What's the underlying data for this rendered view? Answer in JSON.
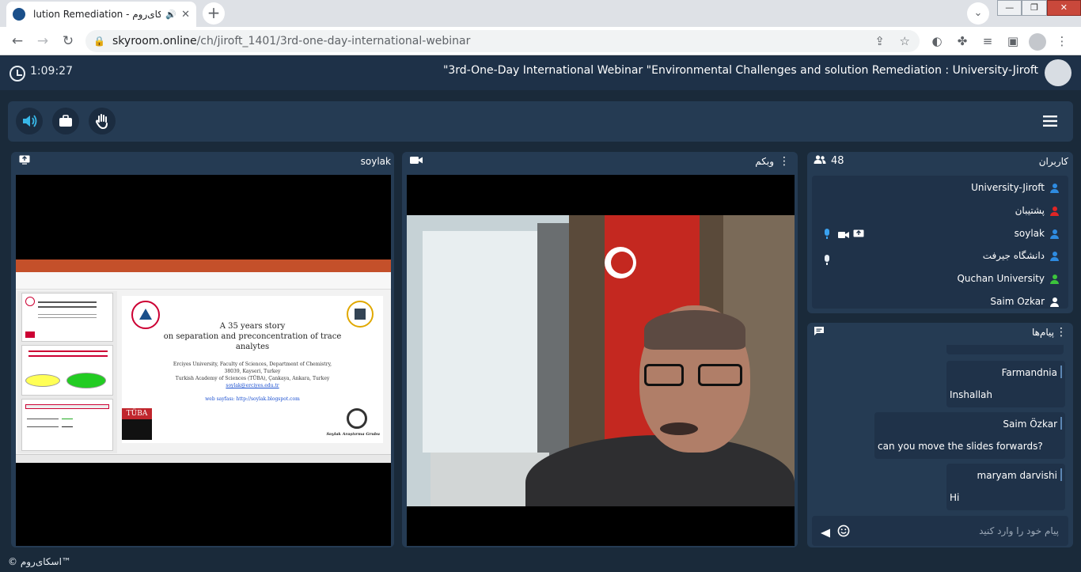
{
  "browser": {
    "tab_title": "lution Remediation - اسکای‌روم",
    "url_host": "skyroom.online",
    "url_path": "/ch/jiroft_1401/3rd-one-day-international-webinar",
    "tab_close": "✕",
    "new_tab": "+",
    "tab_menu": "⌄"
  },
  "header": {
    "timer": "1:09:27",
    "room_title": "\"3rd-One-Day International Webinar \"Environmental Challenges and solution Remediation : University-Jiroft"
  },
  "presentation_panel": {
    "title": "soylak",
    "slide": {
      "title_lines": [
        "A 35 years story",
        "on separation and preconcentration of trace",
        "analytes"
      ],
      "affiliation_lines": [
        "Erciyes University, Faculty of Sciences, Department of Chemistry,",
        "38039, Kayseri, Turkey",
        "Turkish Academy of Sciences (TÜBA), Çankaya, Ankara, Turkey",
        "soylak@erciyes.edu.tr"
      ],
      "website": "web sayfası:   http://soylak.blogspot.com",
      "logo_text": "TÜBA",
      "brand": "Soylak Araştırma Grubu"
    }
  },
  "webcam_panel": {
    "title": "وبکم"
  },
  "users_panel": {
    "title": "کاربران",
    "count": "48",
    "users": [
      {
        "name": "University-Jiroft",
        "color": "#2e8be0"
      },
      {
        "name": "پشتیبان",
        "color": "#e02525"
      },
      {
        "name": "soylak",
        "color": "#2e8be0"
      },
      {
        "name": "دانشگاه جیرفت",
        "color": "#2e8be0"
      },
      {
        "name": "Quchan University",
        "color": "#3cc43c"
      },
      {
        "name": "Saim Ozkar",
        "color": "#ffffff"
      }
    ]
  },
  "chat_panel": {
    "title": "پیام‌ها",
    "messages": [
      {
        "sender": "Farmandnia",
        "text": "Inshallah"
      },
      {
        "sender": "Saim Özkar",
        "text": "can you move the slides forwards?"
      },
      {
        "sender": "maryam darvishi",
        "text": "Hi"
      }
    ],
    "input_placeholder": "پیام خود را وارد کنید"
  },
  "footer": {
    "copyright": "© اسکای‌روم™"
  },
  "colors": {
    "bg": "#1a2a3a",
    "panel": "#253b53",
    "accent": "#38b7e8"
  }
}
